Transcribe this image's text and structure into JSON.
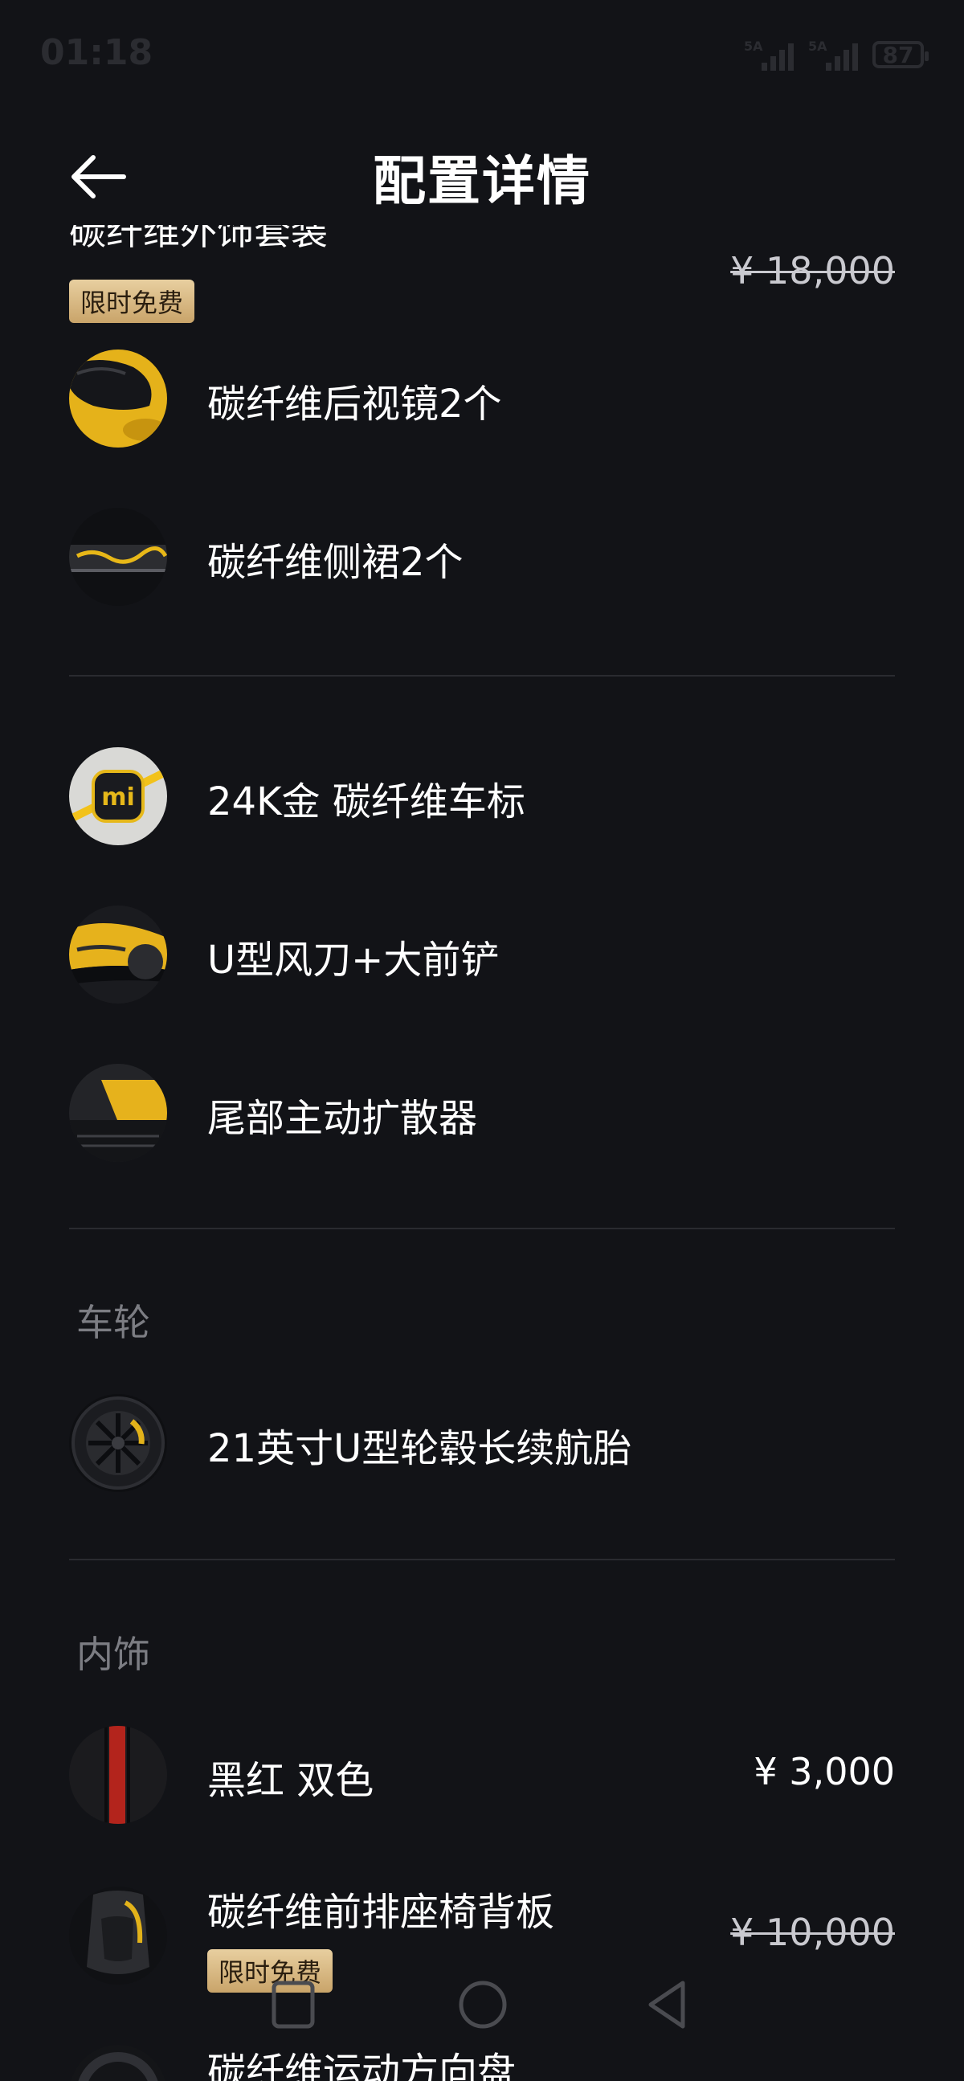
{
  "status_bar": {
    "time": "01:18",
    "sim1": "5A",
    "sim2": "5A",
    "battery": "87"
  },
  "header": {
    "title": "配置详情",
    "back_icon": "back-arrow-icon"
  },
  "exterior_package": {
    "title": "碳纤维外饰套装",
    "price": "¥ 18,000",
    "badge": "限时免费",
    "items": [
      {
        "label": "碳纤维后视镜2个",
        "icon": "side-mirror-thumbnail"
      },
      {
        "label": "碳纤维侧裙2个",
        "icon": "side-skirt-thumbnail"
      }
    ]
  },
  "exterior_options": [
    {
      "label": "24K金 碳纤维车标",
      "icon": "logo-badge-thumbnail"
    },
    {
      "label": "U型风刀+大前铲",
      "icon": "front-splitter-thumbnail"
    },
    {
      "label": "尾部主动扩散器",
      "icon": "rear-diffuser-thumbnail"
    }
  ],
  "wheels": {
    "section_title": "车轮",
    "items": [
      {
        "label": "21英寸U型轮毂长续航胎",
        "icon": "wheel-thumbnail"
      }
    ]
  },
  "interior": {
    "section_title": "内饰",
    "items": [
      {
        "label": "黑红 双色",
        "price": "¥ 3,000",
        "icon": "seat-color-thumbnail"
      },
      {
        "label": "碳纤维前排座椅背板",
        "price": "¥ 10,000",
        "badge": "限时免费",
        "icon": "seat-back-thumbnail"
      },
      {
        "label": "碳纤维运动方向盘",
        "icon": "steering-wheel-thumbnail"
      }
    ]
  },
  "colors": {
    "background": "#121317",
    "divider": "#2a2b30",
    "section_title": "#7c7d83",
    "badge": "#d8b784",
    "accent_yellow": "#f2c21a"
  },
  "nav_bar": {
    "buttons": [
      "recent-apps-icon",
      "home-icon",
      "back-icon"
    ]
  }
}
